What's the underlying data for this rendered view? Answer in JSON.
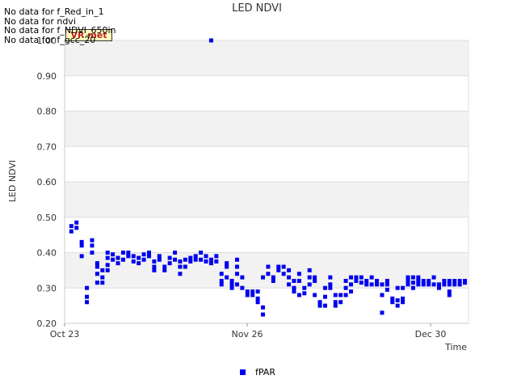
{
  "no_data_messages": [
    "No data for f_Red_in_1",
    "No data for ndvi",
    "No data for f_NDVI_650in",
    "No data for f_gcc_20"
  ],
  "badge_label": "VR met",
  "chart_data": {
    "type": "scatter",
    "title": "LED NDVI",
    "xlabel": "Time",
    "ylabel": "LED NDVI",
    "ylim": [
      0.2,
      1.0
    ],
    "yticks": [
      0.2,
      0.3,
      0.4,
      0.5,
      0.6,
      0.7,
      0.8,
      0.9,
      1.0
    ],
    "ytick_labels": [
      "0.20",
      "0.30",
      "0.40",
      "0.50",
      "0.60",
      "0.70",
      "0.80",
      "0.90",
      "1.00"
    ],
    "xlim_day": [
      0,
      69
    ],
    "xticks": [
      {
        "day": 0,
        "label": "Oct 23"
      },
      {
        "day": 34,
        "label": "Nov 26"
      },
      {
        "day": 68,
        "label": "Dec 30"
      }
    ],
    "grid": true,
    "legend_position": "bottom-center",
    "color": "#0000ee",
    "series": [
      {
        "name": "fPAR",
        "points": [
          [
            1,
            0.46
          ],
          [
            1,
            0.475
          ],
          [
            2,
            0.47
          ],
          [
            2,
            0.485
          ],
          [
            3,
            0.42
          ],
          [
            3,
            0.43
          ],
          [
            3,
            0.39
          ],
          [
            4,
            0.26
          ],
          [
            4,
            0.275
          ],
          [
            4,
            0.3
          ],
          [
            5,
            0.4
          ],
          [
            5,
            0.42
          ],
          [
            5,
            0.435
          ],
          [
            6,
            0.36
          ],
          [
            6,
            0.37
          ],
          [
            6,
            0.315
          ],
          [
            6,
            0.34
          ],
          [
            7,
            0.35
          ],
          [
            7,
            0.33
          ],
          [
            7,
            0.315
          ],
          [
            8,
            0.35
          ],
          [
            8,
            0.365
          ],
          [
            8,
            0.385
          ],
          [
            8,
            0.4
          ],
          [
            9,
            0.38
          ],
          [
            9,
            0.395
          ],
          [
            10,
            0.37
          ],
          [
            10,
            0.385
          ],
          [
            11,
            0.38
          ],
          [
            11,
            0.4
          ],
          [
            12,
            0.39
          ],
          [
            12,
            0.4
          ],
          [
            13,
            0.375
          ],
          [
            13,
            0.39
          ],
          [
            14,
            0.37
          ],
          [
            14,
            0.385
          ],
          [
            15,
            0.38
          ],
          [
            15,
            0.395
          ],
          [
            16,
            0.39
          ],
          [
            16,
            0.4
          ],
          [
            17,
            0.36
          ],
          [
            17,
            0.35
          ],
          [
            17,
            0.375
          ],
          [
            18,
            0.38
          ],
          [
            18,
            0.39
          ],
          [
            19,
            0.36
          ],
          [
            19,
            0.35
          ],
          [
            20,
            0.37
          ],
          [
            20,
            0.385
          ],
          [
            21,
            0.38
          ],
          [
            21,
            0.4
          ],
          [
            22,
            0.34
          ],
          [
            22,
            0.36
          ],
          [
            22,
            0.375
          ],
          [
            23,
            0.36
          ],
          [
            23,
            0.38
          ],
          [
            24,
            0.375
          ],
          [
            24,
            0.385
          ],
          [
            25,
            0.38
          ],
          [
            25,
            0.39
          ],
          [
            26,
            0.38
          ],
          [
            26,
            0.4
          ],
          [
            27,
            0.39
          ],
          [
            27,
            0.375
          ],
          [
            28,
            0.37
          ],
          [
            28,
            0.38
          ],
          [
            28,
            1.0
          ],
          [
            29,
            0.39
          ],
          [
            29,
            0.375
          ],
          [
            30,
            0.34
          ],
          [
            30,
            0.32
          ],
          [
            30,
            0.31
          ],
          [
            31,
            0.36
          ],
          [
            31,
            0.37
          ],
          [
            31,
            0.33
          ],
          [
            32,
            0.31
          ],
          [
            32,
            0.32
          ],
          [
            32,
            0.3
          ],
          [
            33,
            0.38
          ],
          [
            33,
            0.36
          ],
          [
            33,
            0.34
          ],
          [
            33,
            0.31
          ],
          [
            34,
            0.33
          ],
          [
            34,
            0.3
          ],
          [
            35,
            0.29
          ],
          [
            35,
            0.28
          ],
          [
            36,
            0.29
          ],
          [
            36,
            0.28
          ],
          [
            37,
            0.27
          ],
          [
            37,
            0.26
          ],
          [
            37,
            0.29
          ],
          [
            38,
            0.245
          ],
          [
            38,
            0.225
          ],
          [
            38,
            0.33
          ],
          [
            39,
            0.34
          ],
          [
            39,
            0.36
          ],
          [
            40,
            0.32
          ],
          [
            40,
            0.33
          ],
          [
            41,
            0.35
          ],
          [
            41,
            0.36
          ],
          [
            42,
            0.34
          ],
          [
            42,
            0.36
          ],
          [
            43,
            0.33
          ],
          [
            43,
            0.35
          ],
          [
            43,
            0.31
          ],
          [
            44,
            0.29
          ],
          [
            44,
            0.3
          ],
          [
            44,
            0.32
          ],
          [
            45,
            0.34
          ],
          [
            45,
            0.32
          ],
          [
            45,
            0.28
          ],
          [
            46,
            0.3
          ],
          [
            46,
            0.285
          ],
          [
            47,
            0.33
          ],
          [
            47,
            0.35
          ],
          [
            47,
            0.31
          ],
          [
            48,
            0.33
          ],
          [
            48,
            0.32
          ],
          [
            48,
            0.28
          ],
          [
            49,
            0.26
          ],
          [
            49,
            0.25
          ],
          [
            50,
            0.3
          ],
          [
            50,
            0.275
          ],
          [
            50,
            0.25
          ],
          [
            51,
            0.33
          ],
          [
            51,
            0.31
          ],
          [
            51,
            0.3
          ],
          [
            52,
            0.28
          ],
          [
            52,
            0.26
          ],
          [
            52,
            0.25
          ],
          [
            53,
            0.28
          ],
          [
            53,
            0.26
          ],
          [
            54,
            0.32
          ],
          [
            54,
            0.3
          ],
          [
            54,
            0.28
          ],
          [
            55,
            0.29
          ],
          [
            55,
            0.31
          ],
          [
            55,
            0.33
          ],
          [
            56,
            0.32
          ],
          [
            56,
            0.33
          ],
          [
            57,
            0.315
          ],
          [
            57,
            0.33
          ],
          [
            58,
            0.31
          ],
          [
            58,
            0.32
          ],
          [
            59,
            0.31
          ],
          [
            59,
            0.33
          ],
          [
            60,
            0.31
          ],
          [
            60,
            0.32
          ],
          [
            61,
            0.28
          ],
          [
            61,
            0.23
          ],
          [
            61,
            0.31
          ],
          [
            62,
            0.31
          ],
          [
            62,
            0.32
          ],
          [
            62,
            0.295
          ],
          [
            63,
            0.26
          ],
          [
            63,
            0.27
          ],
          [
            64,
            0.25
          ],
          [
            64,
            0.265
          ],
          [
            64,
            0.3
          ],
          [
            65,
            0.26
          ],
          [
            65,
            0.27
          ],
          [
            65,
            0.3
          ],
          [
            66,
            0.31
          ],
          [
            66,
            0.33
          ],
          [
            66,
            0.32
          ],
          [
            67,
            0.3
          ],
          [
            67,
            0.315
          ],
          [
            67,
            0.33
          ],
          [
            68,
            0.31
          ],
          [
            68,
            0.33
          ],
          [
            68,
            0.32
          ],
          [
            69,
            0.31
          ],
          [
            69,
            0.32
          ],
          [
            70,
            0.32
          ],
          [
            70,
            0.31
          ],
          [
            71,
            0.33
          ],
          [
            71,
            0.31
          ],
          [
            72,
            0.31
          ],
          [
            72,
            0.3
          ],
          [
            73,
            0.32
          ],
          [
            73,
            0.31
          ],
          [
            74,
            0.28
          ],
          [
            74,
            0.29
          ],
          [
            74,
            0.31
          ],
          [
            74,
            0.32
          ],
          [
            75,
            0.31
          ],
          [
            75,
            0.32
          ],
          [
            76,
            0.31
          ],
          [
            76,
            0.32
          ],
          [
            77,
            0.315
          ],
          [
            77,
            0.32
          ]
        ]
      }
    ]
  }
}
